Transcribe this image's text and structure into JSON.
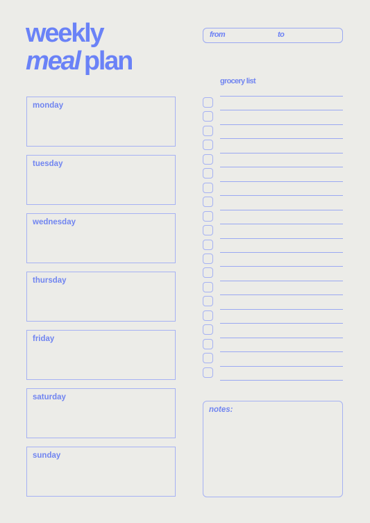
{
  "title": {
    "line1": "weekly",
    "line2_italic": "meal",
    "line2_regular": "plan"
  },
  "date_range": {
    "from_label": "from",
    "to_label": "to"
  },
  "days": [
    {
      "italic": "mon",
      "regular": "day"
    },
    {
      "italic": "",
      "regular": "tues",
      "regular2": "day",
      "italic_mid": "",
      "full": "tuesday"
    },
    {
      "full": "wednesday"
    },
    {
      "full": "thursday"
    },
    {
      "full": "friday"
    },
    {
      "full": "saturday"
    },
    {
      "full": "sunday"
    }
  ],
  "day_labels": [
    "monday",
    "tuesday",
    "wednesday",
    "thursday",
    "friday",
    "saturday",
    "sunday"
  ],
  "grocery": {
    "title": "grocery list",
    "checkbox_count": 20,
    "line_count": 21
  },
  "notes": {
    "label": "notes:"
  },
  "colors": {
    "background": "#ecece8",
    "accent": "#6a82f7",
    "border": "#a5b1f3"
  }
}
